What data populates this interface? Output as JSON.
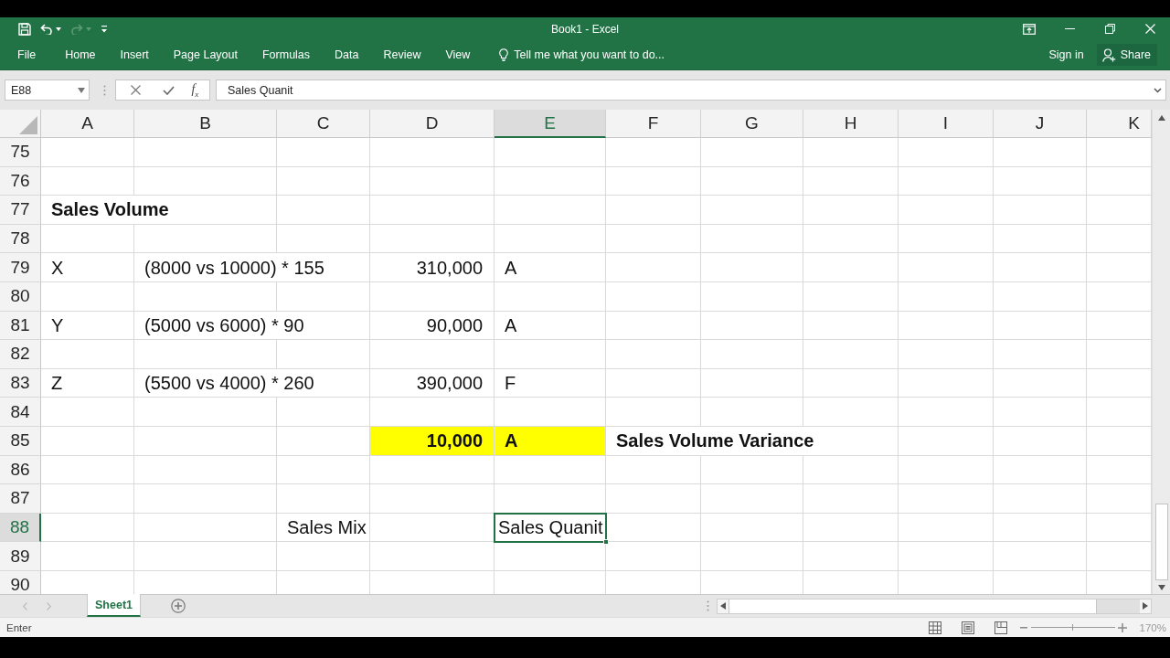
{
  "window": {
    "title": "Book1 - Excel"
  },
  "quick_access": [
    {
      "kind": "save",
      "disabled": false
    },
    {
      "kind": "undo",
      "disabled": false
    },
    {
      "kind": "redo",
      "disabled": true
    },
    {
      "kind": "customize",
      "disabled": false
    }
  ],
  "window_controls": [
    {
      "kind": "ribbon_options"
    },
    {
      "kind": "minimize"
    },
    {
      "kind": "restore"
    },
    {
      "kind": "close"
    }
  ],
  "ribbon": {
    "tabs": [
      {
        "label": "File",
        "selected": false
      },
      {
        "label": "Home",
        "selected": false
      },
      {
        "label": "Insert",
        "selected": false
      },
      {
        "label": "Page Layout",
        "selected": false
      },
      {
        "label": "Formulas",
        "selected": false
      },
      {
        "label": "Data",
        "selected": false
      },
      {
        "label": "Review",
        "selected": false
      },
      {
        "label": "View",
        "selected": false
      }
    ],
    "tell_me": {
      "placeholder": "Tell me what you want to do..."
    },
    "sign_in": "Sign in",
    "share": "Share"
  },
  "formula_bar": {
    "name_box": "E88",
    "function_button": "f$_{x}$",
    "value": "Sales Quanit"
  },
  "sheet": {
    "columns": [
      {
        "label": "A",
        "selected": false
      },
      {
        "label": "B",
        "selected": false
      },
      {
        "label": "C",
        "selected": false
      },
      {
        "label": "D",
        "selected": false
      },
      {
        "label": "E",
        "selected": true
      },
      {
        "label": "F",
        "selected": false
      },
      {
        "label": "G",
        "selected": false
      },
      {
        "label": "H",
        "selected": false
      },
      {
        "label": "I",
        "selected": false
      },
      {
        "label": "J",
        "selected": false
      },
      {
        "label": "K",
        "selected": false
      }
    ],
    "rows": [
      {
        "number": "75",
        "selected": false,
        "cells": [
          {
            "selected": false
          },
          {
            "selected": false
          },
          {
            "selected": false
          },
          {
            "selected": false
          },
          {
            "selected": false
          },
          {
            "selected": false
          },
          {
            "selected": false
          },
          {
            "selected": false
          },
          {
            "selected": false
          },
          {
            "selected": false
          },
          {
            "selected": false
          }
        ]
      },
      {
        "number": "76",
        "selected": false,
        "cells": [
          {
            "selected": false
          },
          {
            "selected": false
          },
          {
            "selected": false
          },
          {
            "selected": false
          },
          {
            "selected": false
          },
          {
            "selected": false
          },
          {
            "selected": false
          },
          {
            "selected": false
          },
          {
            "selected": false
          },
          {
            "selected": false
          },
          {
            "selected": false
          }
        ]
      },
      {
        "number": "77",
        "selected": false,
        "cells": [
          {
            "selected": false,
            "kind": "text",
            "text": "Sales Volume",
            "bold": true
          },
          {
            "selected": false
          },
          {
            "selected": false
          },
          {
            "selected": false
          },
          {
            "selected": false
          },
          {
            "selected": false
          },
          {
            "selected": false
          },
          {
            "selected": false
          },
          {
            "selected": false
          },
          {
            "selected": false
          },
          {
            "selected": false
          }
        ]
      },
      {
        "number": "78",
        "selected": false,
        "cells": [
          {
            "selected": false
          },
          {
            "selected": false
          },
          {
            "selected": false
          },
          {
            "selected": false
          },
          {
            "selected": false
          },
          {
            "selected": false
          },
          {
            "selected": false
          },
          {
            "selected": false
          },
          {
            "selected": false
          },
          {
            "selected": false
          },
          {
            "selected": false
          }
        ]
      },
      {
        "number": "79",
        "selected": false,
        "cells": [
          {
            "selected": false,
            "kind": "text",
            "text": "X",
            "bold": false
          },
          {
            "selected": false,
            "kind": "text",
            "text": "(8000 vs 10000) * 155",
            "bold": false
          },
          {
            "selected": false
          },
          {
            "selected": false,
            "kind": "number",
            "text": "310,000",
            "bold": false
          },
          {
            "selected": false,
            "kind": "text",
            "text": "A",
            "bold": false
          },
          {
            "selected": false
          },
          {
            "selected": false
          },
          {
            "selected": false
          },
          {
            "selected": false
          },
          {
            "selected": false
          },
          {
            "selected": false
          }
        ]
      },
      {
        "number": "80",
        "selected": false,
        "cells": [
          {
            "selected": false
          },
          {
            "selected": false
          },
          {
            "selected": false
          },
          {
            "selected": false
          },
          {
            "selected": false
          },
          {
            "selected": false
          },
          {
            "selected": false
          },
          {
            "selected": false
          },
          {
            "selected": false
          },
          {
            "selected": false
          },
          {
            "selected": false
          }
        ]
      },
      {
        "number": "81",
        "selected": false,
        "cells": [
          {
            "selected": false,
            "kind": "text",
            "text": "Y",
            "bold": false
          },
          {
            "selected": false,
            "kind": "text",
            "text": "(5000 vs 6000) * 90",
            "bold": false
          },
          {
            "selected": false
          },
          {
            "selected": false,
            "kind": "number",
            "text": "90,000",
            "bold": false
          },
          {
            "selected": false,
            "kind": "text",
            "text": "A",
            "bold": false
          },
          {
            "selected": false
          },
          {
            "selected": false
          },
          {
            "selected": false
          },
          {
            "selected": false
          },
          {
            "selected": false
          },
          {
            "selected": false
          }
        ]
      },
      {
        "number": "82",
        "selected": false,
        "cells": [
          {
            "selected": false
          },
          {
            "selected": false
          },
          {
            "selected": false
          },
          {
            "selected": false
          },
          {
            "selected": false
          },
          {
            "selected": false
          },
          {
            "selected": false
          },
          {
            "selected": false
          },
          {
            "selected": false
          },
          {
            "selected": false
          },
          {
            "selected": false
          }
        ]
      },
      {
        "number": "83",
        "selected": false,
        "cells": [
          {
            "selected": false,
            "kind": "text",
            "text": "Z",
            "bold": false
          },
          {
            "selected": false,
            "kind": "text",
            "text": "(5500 vs 4000) * 260",
            "bold": false
          },
          {
            "selected": false
          },
          {
            "selected": false,
            "kind": "number",
            "text": "390,000",
            "bold": false
          },
          {
            "selected": false,
            "kind": "text",
            "text": "F",
            "bold": false
          },
          {
            "selected": false
          },
          {
            "selected": false
          },
          {
            "selected": false
          },
          {
            "selected": false
          },
          {
            "selected": false
          },
          {
            "selected": false
          }
        ]
      },
      {
        "number": "84",
        "selected": false,
        "cells": [
          {
            "selected": false
          },
          {
            "selected": false
          },
          {
            "selected": false
          },
          {
            "selected": false
          },
          {
            "selected": false
          },
          {
            "selected": false
          },
          {
            "selected": false
          },
          {
            "selected": false
          },
          {
            "selected": false
          },
          {
            "selected": false
          },
          {
            "selected": false
          }
        ]
      },
      {
        "number": "85",
        "selected": false,
        "cells": [
          {
            "selected": false
          },
          {
            "selected": false
          },
          {
            "selected": false
          },
          {
            "selected": false,
            "kind": "number",
            "text": "10,000",
            "bold": true,
            "color": "#ffff00"
          },
          {
            "selected": false,
            "kind": "text",
            "text": "A",
            "bold": true,
            "color": "#ffff00"
          },
          {
            "selected": false,
            "kind": "text",
            "text": "Sales Volume Variance",
            "bold": true
          },
          {
            "selected": false
          },
          {
            "selected": false
          },
          {
            "selected": false
          },
          {
            "selected": false
          },
          {
            "selected": false
          }
        ]
      },
      {
        "number": "86",
        "selected": false,
        "cells": [
          {
            "selected": false
          },
          {
            "selected": false
          },
          {
            "selected": false
          },
          {
            "selected": false
          },
          {
            "selected": false
          },
          {
            "selected": false
          },
          {
            "selected": false
          },
          {
            "selected": false
          },
          {
            "selected": false
          },
          {
            "selected": false
          },
          {
            "selected": false
          }
        ]
      },
      {
        "number": "87",
        "selected": false,
        "cells": [
          {
            "selected": false
          },
          {
            "selected": false
          },
          {
            "selected": false
          },
          {
            "selected": false
          },
          {
            "selected": false
          },
          {
            "selected": false
          },
          {
            "selected": false
          },
          {
            "selected": false
          },
          {
            "selected": false
          },
          {
            "selected": false
          },
          {
            "selected": false
          }
        ]
      },
      {
        "number": "88",
        "selected": true,
        "cells": [
          {
            "selected": false
          },
          {
            "selected": false
          },
          {
            "selected": false,
            "kind": "text",
            "text": "Sales Mix",
            "bold": false
          },
          {
            "selected": false
          },
          {
            "selected": true,
            "kind": "text",
            "text": "Sales Quanit",
            "bold": false
          },
          {
            "selected": false
          },
          {
            "selected": false
          },
          {
            "selected": false
          },
          {
            "selected": false
          },
          {
            "selected": false
          },
          {
            "selected": false
          }
        ]
      },
      {
        "number": "89",
        "selected": false,
        "cells": [
          {
            "selected": false
          },
          {
            "selected": false
          },
          {
            "selected": false
          },
          {
            "selected": false
          },
          {
            "selected": false
          },
          {
            "selected": false
          },
          {
            "selected": false
          },
          {
            "selected": false
          },
          {
            "selected": false
          },
          {
            "selected": false
          },
          {
            "selected": false
          }
        ]
      },
      {
        "number": "90",
        "selected": false,
        "cells": [
          {
            "selected": false
          },
          {
            "selected": false
          },
          {
            "selected": false
          },
          {
            "selected": false
          },
          {
            "selected": false
          },
          {
            "selected": false
          },
          {
            "selected": false
          },
          {
            "selected": false
          },
          {
            "selected": false
          },
          {
            "selected": false
          },
          {
            "selected": false
          }
        ]
      }
    ]
  },
  "sheet_tabs": [
    {
      "label": "Sheet1",
      "selected": true
    }
  ],
  "status_bar": {
    "mode": "Enter",
    "views": [
      {
        "kind": "normal"
      },
      {
        "kind": "page_layout"
      },
      {
        "kind": "page_break"
      }
    ],
    "zoom_slider": {
      "level": 0.5
    },
    "zoom": "170%"
  }
}
